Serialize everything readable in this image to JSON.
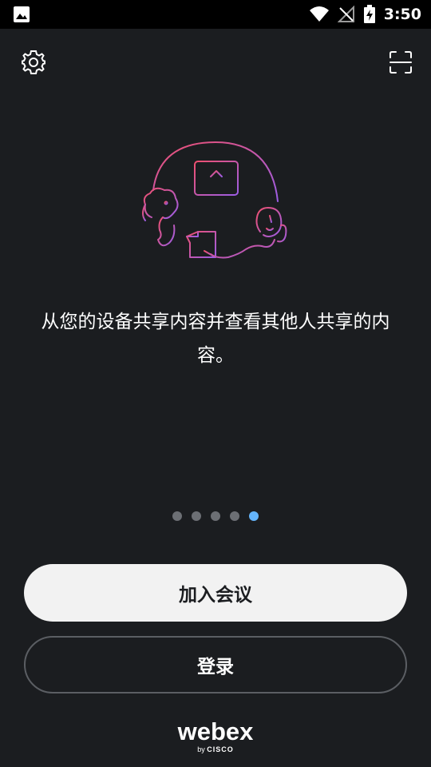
{
  "status_bar": {
    "time": "3:50",
    "icons": [
      "image-icon",
      "wifi-icon",
      "no-signal-icon",
      "battery-charging-icon"
    ]
  },
  "toolbar": {
    "settings_icon": "gear-icon",
    "scan_icon": "scan-frame-icon"
  },
  "onboarding": {
    "illustration_icon": "share-content-illustration",
    "description": "从您的设备共享内容并查看其他人共享的内容。",
    "page_count": 5,
    "active_page": 5
  },
  "actions": {
    "join_label": "加入会议",
    "signin_label": "登录"
  },
  "branding": {
    "wordmark": "webex",
    "by": "by",
    "company": "CISCO"
  },
  "colors": {
    "background": "#1b1d20",
    "accent_active_dot": "#64b4fa",
    "illustration_gradient_start": "#f0506e",
    "illustration_gradient_end": "#9b5de5"
  }
}
